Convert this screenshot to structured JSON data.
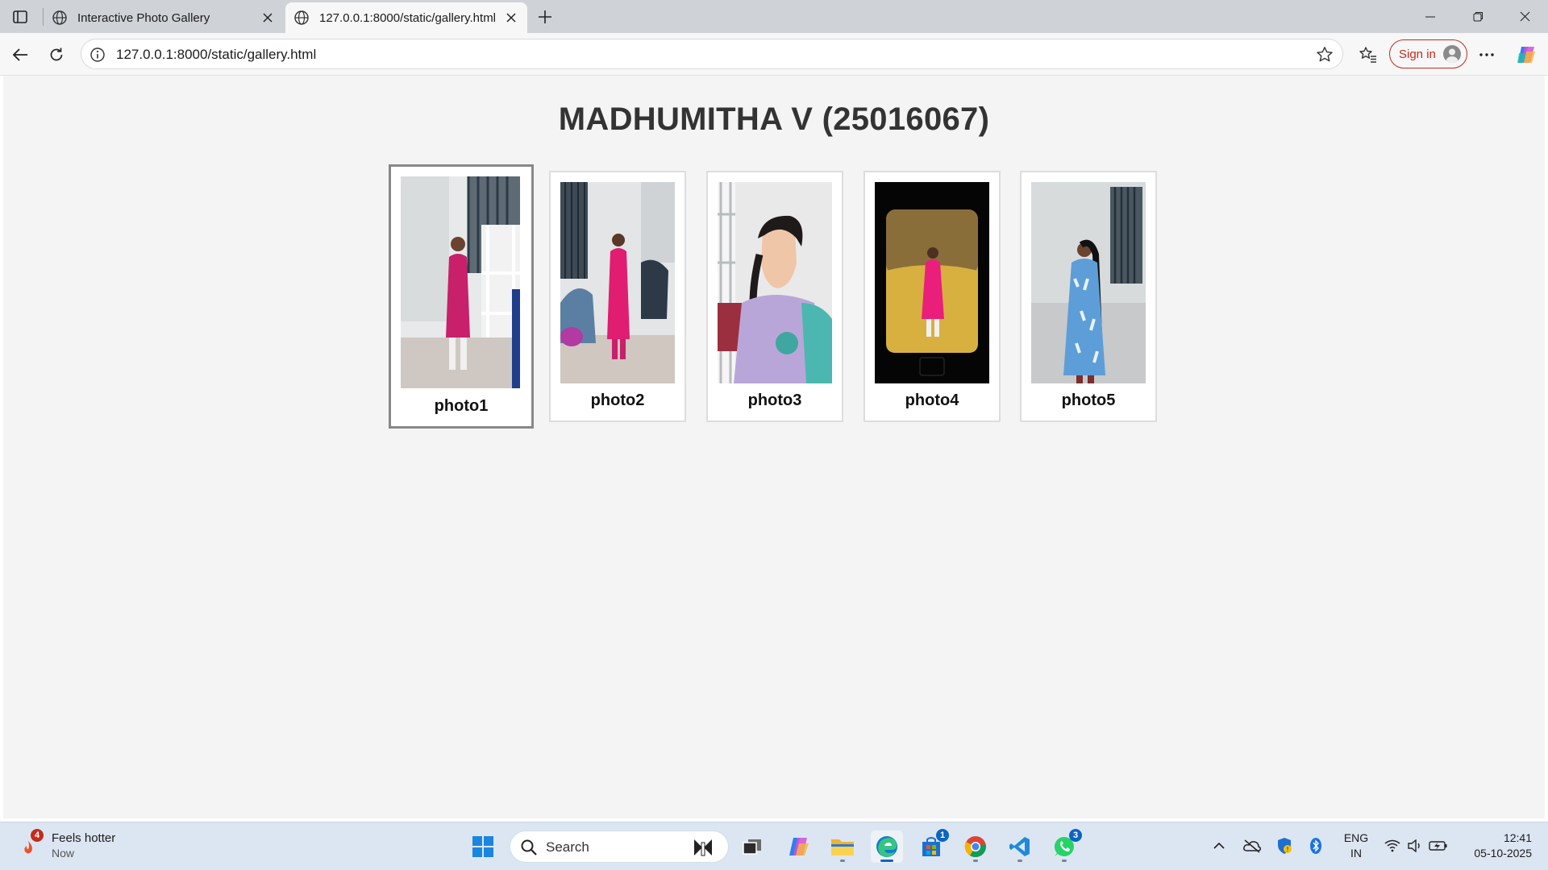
{
  "browser": {
    "tabs": [
      {
        "title": "Interactive Photo Gallery",
        "active": false
      },
      {
        "title": "127.0.0.1:8000/static/gallery.html",
        "active": true
      }
    ],
    "address_url": "127.0.0.1:8000/static/gallery.html",
    "sign_in_label": "Sign in",
    "icons": [
      "tab-actions-icon",
      "globe-icon",
      "close-icon",
      "plus-icon",
      "minimize-icon",
      "restore-icon",
      "back-arrow-icon",
      "refresh-icon",
      "info-icon",
      "star-icon",
      "favorites-icon",
      "more-icon",
      "copilot-icon"
    ]
  },
  "page": {
    "heading": "MADHUMITHA V (25016067)",
    "photos": [
      {
        "caption": "photo1",
        "selected": true
      },
      {
        "caption": "photo2",
        "selected": false
      },
      {
        "caption": "photo3",
        "selected": false
      },
      {
        "caption": "photo4",
        "selected": false
      },
      {
        "caption": "photo5",
        "selected": false
      }
    ]
  },
  "taskbar": {
    "weather": {
      "title": "Feels hotter",
      "subtitle": "Now",
      "badge": "4"
    },
    "search_label": "Search",
    "app_badges": {
      "store": "1",
      "whatsapp": "3"
    },
    "language": {
      "line1": "ENG",
      "line2": "IN"
    },
    "clock": {
      "time": "12:41",
      "date": "05-10-2025"
    }
  },
  "colors": {
    "accent_red": "#c42b1c",
    "edge_blue": "#0a64c2",
    "heading_text": "#333333"
  }
}
